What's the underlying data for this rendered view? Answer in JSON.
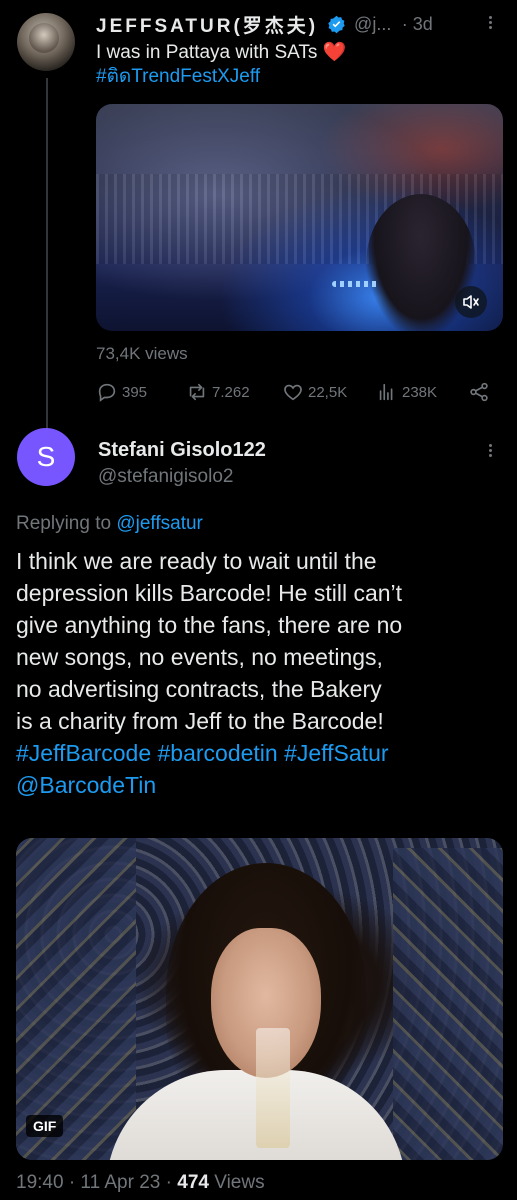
{
  "tweet1": {
    "display_name": "JEFFSATUR(罗杰夫)",
    "handle": "@j...",
    "time": "· 3d",
    "text": "I was in Pattaya with SATs",
    "emoji": "❤️",
    "hashtag": "#ติดTrendFestXJeff",
    "views": "73,4K views",
    "stats": {
      "replies": "395",
      "reposts": "7.262",
      "likes": "22,5K",
      "views": "238K"
    }
  },
  "tweet2": {
    "avatar_letter": "S",
    "display_name": "Stefani Gisolo122",
    "handle": "@stefanigisolo2",
    "replying_prefix": "Replying to",
    "replying_to": "@jeffsatur",
    "body_lines": [
      "I think we are ready to wait until the",
      "depression kills Barcode! He still can’t",
      "give anything to the fans, there are no",
      "new songs, no events, no meetings,",
      "no advertising contracts, the Bakery",
      "is a charity from Jeff to the Barcode!"
    ],
    "hashtags_line": "#JeffBarcode #barcodetin #JeffSatur",
    "mention": "@BarcodeTin",
    "gif_label": "GIF",
    "timestamp": "19:40 · 11 Apr 23 ·",
    "view_count": "474",
    "view_label": "Views"
  },
  "colors": {
    "background": "#000000",
    "text": "#e7e9ea",
    "muted": "#71767b",
    "accent": "#1d9bf0",
    "avatar": "#7856ff"
  },
  "icons": [
    "verified-badge-icon",
    "more-icon",
    "mute-icon",
    "reply-icon",
    "repost-icon",
    "like-icon",
    "views-icon",
    "share-icon"
  ]
}
